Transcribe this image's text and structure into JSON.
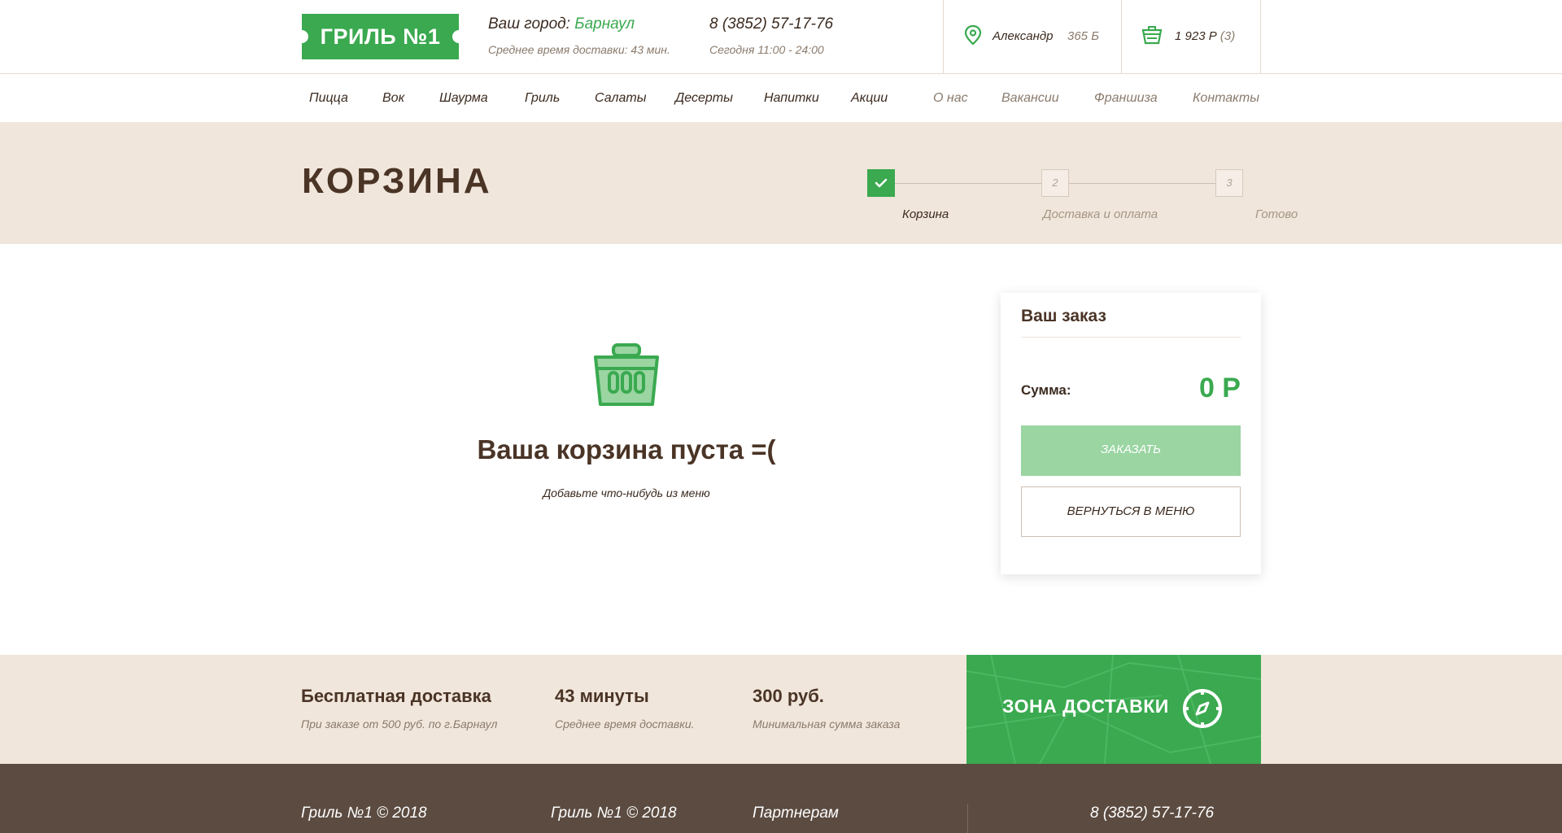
{
  "header": {
    "logo_text": "ГРИЛЬ №1",
    "city_label": "Ваш город:",
    "city_value": "Барнаул",
    "delivery_time": "Среднее время доставки: 43 мин.",
    "phone": "8 (3852) 57-17-76",
    "hours": "Сегодня 11:00 - 24:00",
    "user_name": "Александр",
    "user_bonus": "365 Б",
    "cart_total": "1 923 Р",
    "cart_count": "(3)"
  },
  "nav": {
    "main": [
      "Пицца",
      "Вок",
      "Шаурма",
      "Гриль",
      "Салаты",
      "Десерты",
      "Напитки",
      "Акции"
    ],
    "secondary": [
      "О нас",
      "Вакансии",
      "Франшиза",
      "Контакты"
    ]
  },
  "page": {
    "title": "КОРЗИНА",
    "steps": [
      {
        "number": "1",
        "label": "Корзина",
        "state": "done"
      },
      {
        "number": "2",
        "label": "Доставка и оплата",
        "state": "pending"
      },
      {
        "number": "3",
        "label": "Готово",
        "state": "pending"
      }
    ]
  },
  "empty_cart": {
    "icon": "basket-icon",
    "title": "Ваша корзина пуста =(",
    "subtitle": "Добавьте что-нибудь из меню"
  },
  "order": {
    "title": "Ваш заказ",
    "sum_label": "Сумма:",
    "sum_value": "0 Р",
    "order_button": "ЗАКАЗАТЬ",
    "back_button": "ВЕРНУТЬСЯ В МЕНЮ"
  },
  "features": [
    {
      "title": "Бесплатная доставка",
      "subtitle": "При заказе от 500 руб. по г.Барнаул"
    },
    {
      "title": "43 минуты",
      "subtitle": "Среднее время доставки."
    },
    {
      "title": "300 руб.",
      "subtitle": "Минимальная сумма заказа"
    }
  ],
  "delivery_zone": {
    "label": "ЗОНА ДОСТАВКИ",
    "icon": "compass-icon"
  },
  "footer": {
    "col1": "Гриль №1 © 2018",
    "col2": "Гриль №1 © 2018",
    "col3": "Партнерам",
    "phone": "8 (3852) 57-17-76"
  },
  "colors": {
    "brand_green": "#3aa94f",
    "disabled_green": "#9ad5a2",
    "brown_text": "#4a3426",
    "beige_bg": "#f1e6db",
    "footer_bg": "#5b4b40"
  }
}
